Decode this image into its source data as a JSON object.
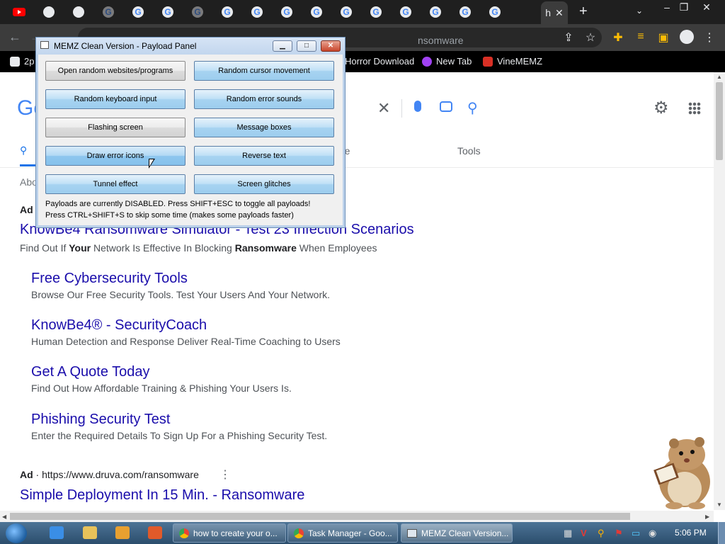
{
  "browser": {
    "omnibox_text": "nsomware",
    "active_tab_label": "h",
    "new_tab_symbol": "+",
    "bookmarks": [
      {
        "label": "2p",
        "color": "#f28b82"
      },
      {
        "label": "Horror Download",
        "color": "#e8eaed"
      },
      {
        "label": "New Tab",
        "color": "#a142f4"
      },
      {
        "label": "VineMEMZ",
        "color": "#d93025"
      }
    ]
  },
  "google": {
    "logo_text": "Go",
    "tab_more": "re",
    "tab_tools": "Tools",
    "about_text": "Abo",
    "ad_label": "Ad",
    "ad1": {
      "title": "KnowBe4 Ransomware Simulator - Test 23 Infection Scenarios",
      "desc_pre": "Find Out If ",
      "desc_b1": "Your",
      "desc_mid": " Network Is Effective In Blocking ",
      "desc_b2": "Ransomware",
      "desc_post": " When Employees"
    },
    "sitelinks": [
      {
        "title": "Free Cybersecurity Tools",
        "desc": "Browse Our Free Security Tools. Test Your Users And Your Network."
      },
      {
        "title": "KnowBe4® - SecurityCoach",
        "desc": "Human Detection and Response Deliver Real-Time Coaching to Users"
      },
      {
        "title": "Get A Quote Today",
        "desc": "Find Out How Affordable Training & Phishing Your Users Is."
      },
      {
        "title": "Phishing Security Test",
        "desc": "Enter the Required Details To Sign Up For a Phishing Security Test."
      }
    ],
    "ad2": {
      "label": "Ad",
      "url": "https://www.druva.com/ransomware",
      "title": "Simple Deployment In 15 Min. - Ransomware"
    }
  },
  "memz": {
    "title": "MEMZ Clean Version - Payload Panel",
    "buttons": [
      "Open random websites/programs",
      "Random cursor movement",
      "Random keyboard input",
      "Random error sounds",
      "Flashing screen",
      "Message boxes",
      "Draw error icons",
      "Reverse text",
      "Tunnel effect",
      "Screen glitches"
    ],
    "note1": "Payloads are currently DISABLED. Press SHIFT+ESC to toggle all payloads!",
    "note2": "Press CTRL+SHIFT+S to skip some time (makes some payloads faster)"
  },
  "taskbar": {
    "tasks": [
      "how to create your o...",
      "Task Manager - Goo...",
      "MEMZ Clean Version..."
    ],
    "clock": "5:06 PM"
  }
}
